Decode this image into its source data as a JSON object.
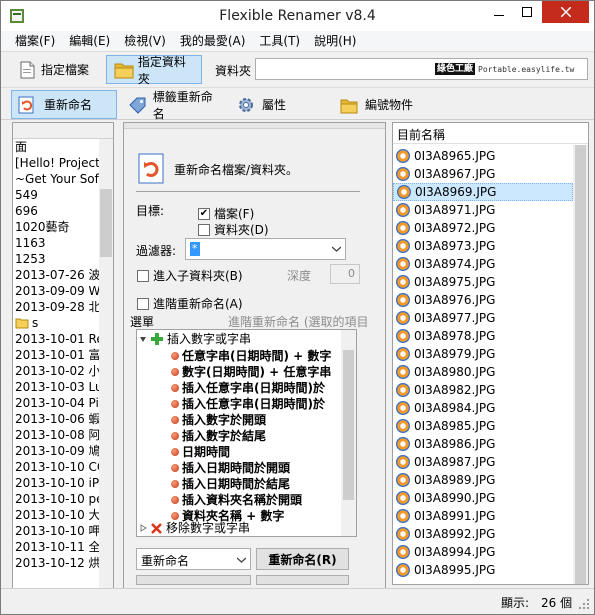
{
  "window": {
    "title": "Flexible Renamer v8.4"
  },
  "menu": [
    "檔案(F)",
    "編輯(E)",
    "檢視(V)",
    "我的最愛(A)",
    "工具(T)",
    "說明(H)"
  ],
  "toolbar": {
    "files_label": "指定檔案",
    "folders_label": "指定資料夾",
    "folder_label": "資料夾",
    "folder_value": "",
    "brand_main": "綠色工廠",
    "brand_sub": "Portable.easylife.tw"
  },
  "modes": {
    "rename": "重新命名",
    "tag": "標籤重新命名",
    "attr": "屬性",
    "number": "編號物件"
  },
  "left_list": [
    {
      "text": "面"
    },
    {
      "text": "[Hello! Project"
    },
    {
      "text": "~Get Your Sof"
    },
    {
      "text": "549"
    },
    {
      "text": "696"
    },
    {
      "text": "1020藝奇"
    },
    {
      "text": "1163"
    },
    {
      "text": "1253"
    },
    {
      "text": "2013-07-26 波"
    },
    {
      "text": "2013-09-09 W"
    },
    {
      "text": "2013-09-28 北"
    },
    {
      "text": "s",
      "folder": true
    },
    {
      "text": "2013-10-01 Re"
    },
    {
      "text": "2013-10-01 富"
    },
    {
      "text": "2013-10-02 小"
    },
    {
      "text": "2013-10-03 Lu"
    },
    {
      "text": "2013-10-04 Pia"
    },
    {
      "text": "2013-10-06 蝦"
    },
    {
      "text": "2013-10-08 阿"
    },
    {
      "text": "2013-10-09 鳩"
    },
    {
      "text": "2013-10-10 CC"
    },
    {
      "text": "2013-10-10 iPh"
    },
    {
      "text": "2013-10-10 pe"
    },
    {
      "text": "2013-10-10 大"
    },
    {
      "text": "2013-10-10 呷"
    },
    {
      "text": "2013-10-11 全"
    },
    {
      "text": "2013-10-12 烘"
    }
  ],
  "middle": {
    "header": "重新命名檔案/資料夾。",
    "target_label": "目標:",
    "file_cb": "檔案(F)",
    "folder_cb": "資料夾(D)",
    "filter_label": "過濾器:",
    "filter_value": "*",
    "subfolder_cb": "進入子資料夾(B)",
    "depth_label": "深度",
    "depth_value": "0",
    "advanced_cb": "進階重新命名(A)",
    "options_label": "選單",
    "advanced_hint": "進階重新命名 (選取的項目",
    "tree": {
      "group1": "插入數字或字串",
      "children": [
        "任意字串(日期時間) + 數字",
        "數字(日期時間) + 任意字串",
        "插入任意字串(日期時間)於",
        "插入任意字串(日期時間)於",
        "插入數字於開頭",
        "插入數字於結尾",
        "日期時間",
        "插入日期時間於開頭",
        "插入日期時間於結尾",
        "插入資料夾名稱於開頭",
        "資料夾名稱 + 數字"
      ],
      "group2": "移除數字或字串"
    },
    "rename_combo": "重新命名",
    "rename_button": "重新命名(R)"
  },
  "right": {
    "header": "目前名稱",
    "selected_index": 2,
    "files": [
      "0I3A8965.JPG",
      "0I3A8967.JPG",
      "0I3A8969.JPG",
      "0I3A8971.JPG",
      "0I3A8972.JPG",
      "0I3A8973.JPG",
      "0I3A8974.JPG",
      "0I3A8975.JPG",
      "0I3A8976.JPG",
      "0I3A8977.JPG",
      "0I3A8978.JPG",
      "0I3A8979.JPG",
      "0I3A8980.JPG",
      "0I3A8982.JPG",
      "0I3A8984.JPG",
      "0I3A8985.JPG",
      "0I3A8986.JPG",
      "0I3A8987.JPG",
      "0I3A8989.JPG",
      "0I3A8990.JPG",
      "0I3A8991.JPG",
      "0I3A8992.JPG",
      "0I3A8994.JPG",
      "0I3A8995.JPG"
    ]
  },
  "status": {
    "label": "顯示:",
    "count": "26 個"
  },
  "colors": {
    "accent": "#cde6f7",
    "selected_row": "#cce8ff",
    "close": "#c42b1c"
  }
}
